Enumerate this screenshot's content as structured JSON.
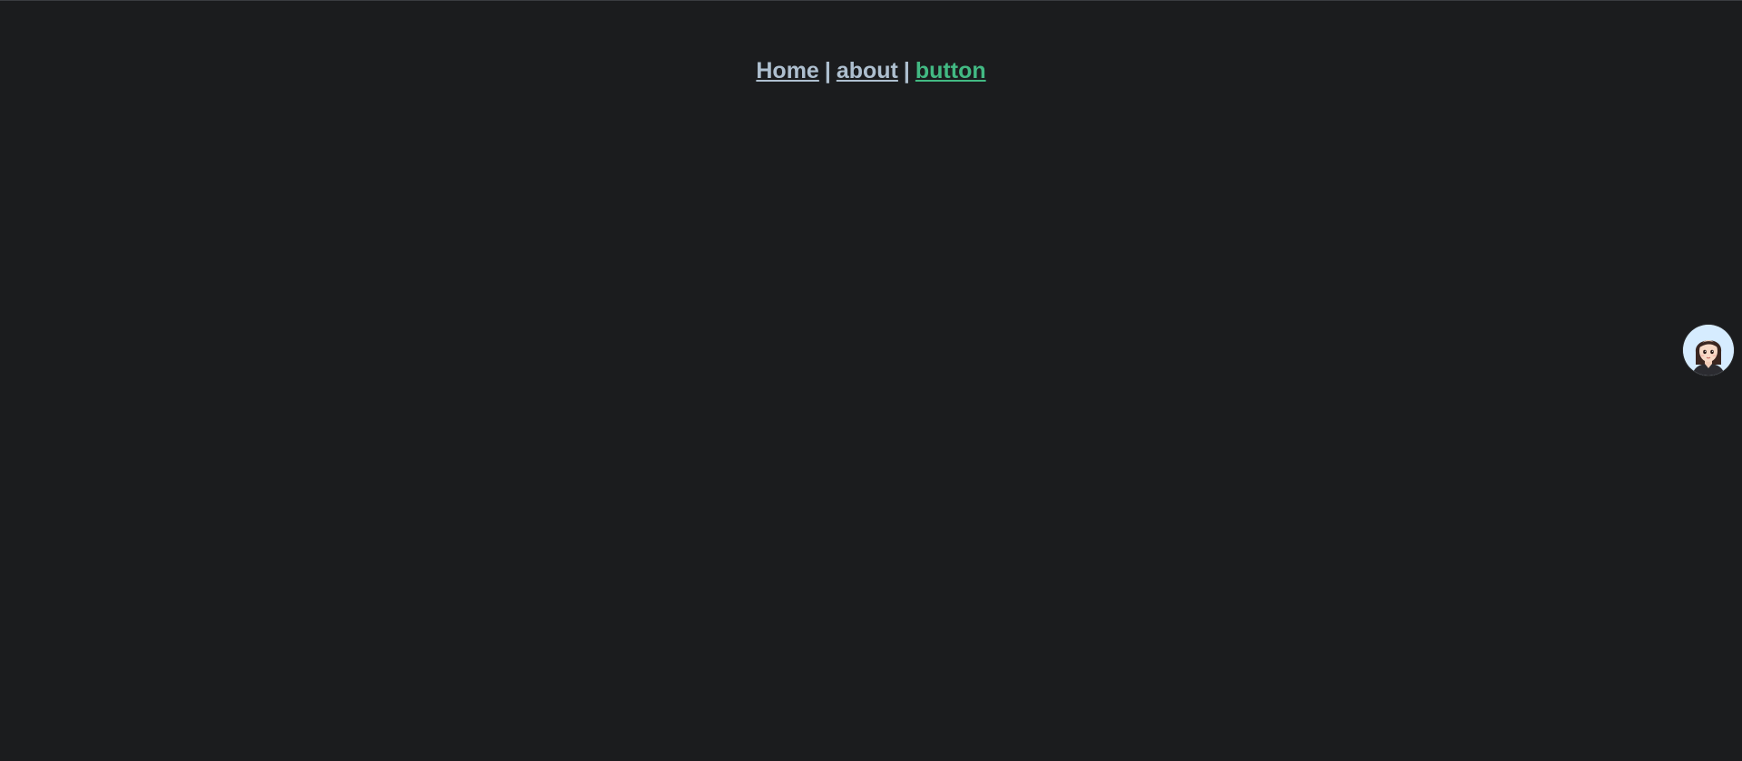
{
  "nav": {
    "links": [
      {
        "label": "Home",
        "state": "default"
      },
      {
        "label": "about",
        "state": "default"
      },
      {
        "label": "button",
        "state": "active"
      }
    ],
    "separator": "|"
  },
  "colors": {
    "background": "#1b1c1e",
    "link": "#aebfcf",
    "link_active": "#42b983",
    "avatar_bg": "#d6ecff"
  },
  "floating_widget": {
    "icon": "assistant-avatar-icon"
  }
}
